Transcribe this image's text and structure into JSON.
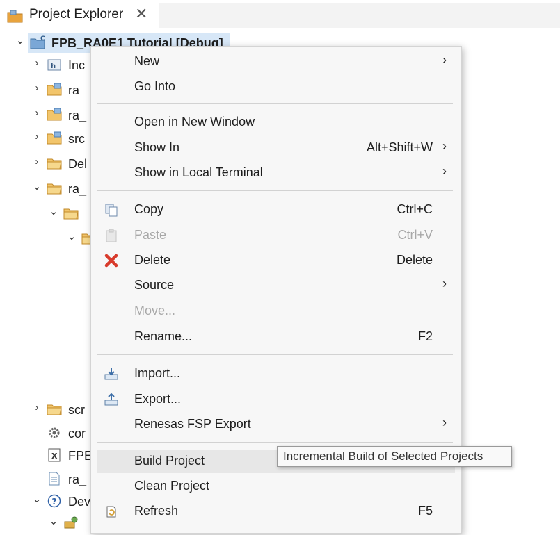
{
  "view": {
    "tab_title": "Project Explorer",
    "tab_close": "✕",
    "tab_icon": "project-explorer-icon"
  },
  "tree": {
    "project": {
      "label": "FPB_RA0E1 Tutorial [Debug]",
      "icon": "c-project-icon"
    },
    "rows": [
      {
        "label": "Inc",
        "twisty": "›",
        "icon": "includes-icon"
      },
      {
        "label": "ra",
        "twisty": "›",
        "icon": "source-folder-icon"
      },
      {
        "label": "ra_",
        "twisty": "›",
        "icon": "source-folder-icon"
      },
      {
        "label": "src",
        "twisty": "›",
        "icon": "source-folder-icon"
      },
      {
        "label": "Del",
        "twisty": "›",
        "icon": "folder-icon"
      },
      {
        "label": "ra_",
        "twisty": "⌄",
        "icon": "folder-icon"
      },
      {
        "label": "",
        "twisty": "⌄",
        "icon": "folder-icon"
      },
      {
        "label": "",
        "twisty": "⌄",
        "icon": "folder-icon"
      },
      {
        "label": "scr",
        "twisty": "›",
        "icon": "folder-icon"
      },
      {
        "label": "cor",
        "twisty": "",
        "icon": "gear-icon"
      },
      {
        "label": "FPE",
        "twisty": "",
        "icon": "xml-file-icon"
      },
      {
        "label": "ra_",
        "twisty": "",
        "icon": "file-icon"
      },
      {
        "label": "Dev",
        "twisty": "⌄",
        "icon": "help-icon"
      },
      {
        "label": "",
        "twisty": "⌄",
        "icon": "device-icon"
      }
    ]
  },
  "menu": {
    "items": [
      {
        "label": "New",
        "shortcut": "",
        "submenu": true,
        "enabled": true,
        "icon": ""
      },
      {
        "label": "Go Into",
        "shortcut": "",
        "submenu": false,
        "enabled": true,
        "icon": ""
      },
      {
        "label": "Open in New Window",
        "shortcut": "",
        "submenu": false,
        "enabled": true,
        "icon": ""
      },
      {
        "label": "Show In",
        "shortcut": "Alt+Shift+W",
        "submenu": true,
        "enabled": true,
        "icon": ""
      },
      {
        "label": "Show in Local Terminal",
        "shortcut": "",
        "submenu": true,
        "enabled": true,
        "icon": ""
      },
      {
        "label": "Copy",
        "shortcut": "Ctrl+C",
        "submenu": false,
        "enabled": true,
        "icon": "copy-icon"
      },
      {
        "label": "Paste",
        "shortcut": "Ctrl+V",
        "submenu": false,
        "enabled": false,
        "icon": "paste-icon"
      },
      {
        "label": "Delete",
        "shortcut": "Delete",
        "submenu": false,
        "enabled": true,
        "icon": "delete-icon"
      },
      {
        "label": "Source",
        "shortcut": "",
        "submenu": true,
        "enabled": true,
        "icon": ""
      },
      {
        "label": "Move...",
        "shortcut": "",
        "submenu": false,
        "enabled": false,
        "icon": ""
      },
      {
        "label": "Rename...",
        "shortcut": "F2",
        "submenu": false,
        "enabled": true,
        "icon": ""
      },
      {
        "label": "Import...",
        "shortcut": "",
        "submenu": false,
        "enabled": true,
        "icon": "import-icon"
      },
      {
        "label": "Export...",
        "shortcut": "",
        "submenu": false,
        "enabled": true,
        "icon": "export-icon"
      },
      {
        "label": "Renesas FSP Export",
        "shortcut": "",
        "submenu": true,
        "enabled": true,
        "icon": ""
      },
      {
        "label": "Build Project",
        "shortcut": "",
        "submenu": false,
        "enabled": true,
        "icon": ""
      },
      {
        "label": "Clean Project",
        "shortcut": "",
        "submenu": false,
        "enabled": true,
        "icon": ""
      },
      {
        "label": "Refresh",
        "shortcut": "F5",
        "submenu": false,
        "enabled": true,
        "icon": "refresh-icon"
      }
    ],
    "submenu_arrow": "›"
  },
  "tooltip": {
    "text": "Incremental Build of Selected Projects"
  },
  "colors": {
    "selection": "#d7e7f7",
    "menu_bg": "#f7f7f7",
    "hover": "#e7e7e7",
    "delete_red": "#d83b2c",
    "folder_orange": "#e8a33d"
  }
}
